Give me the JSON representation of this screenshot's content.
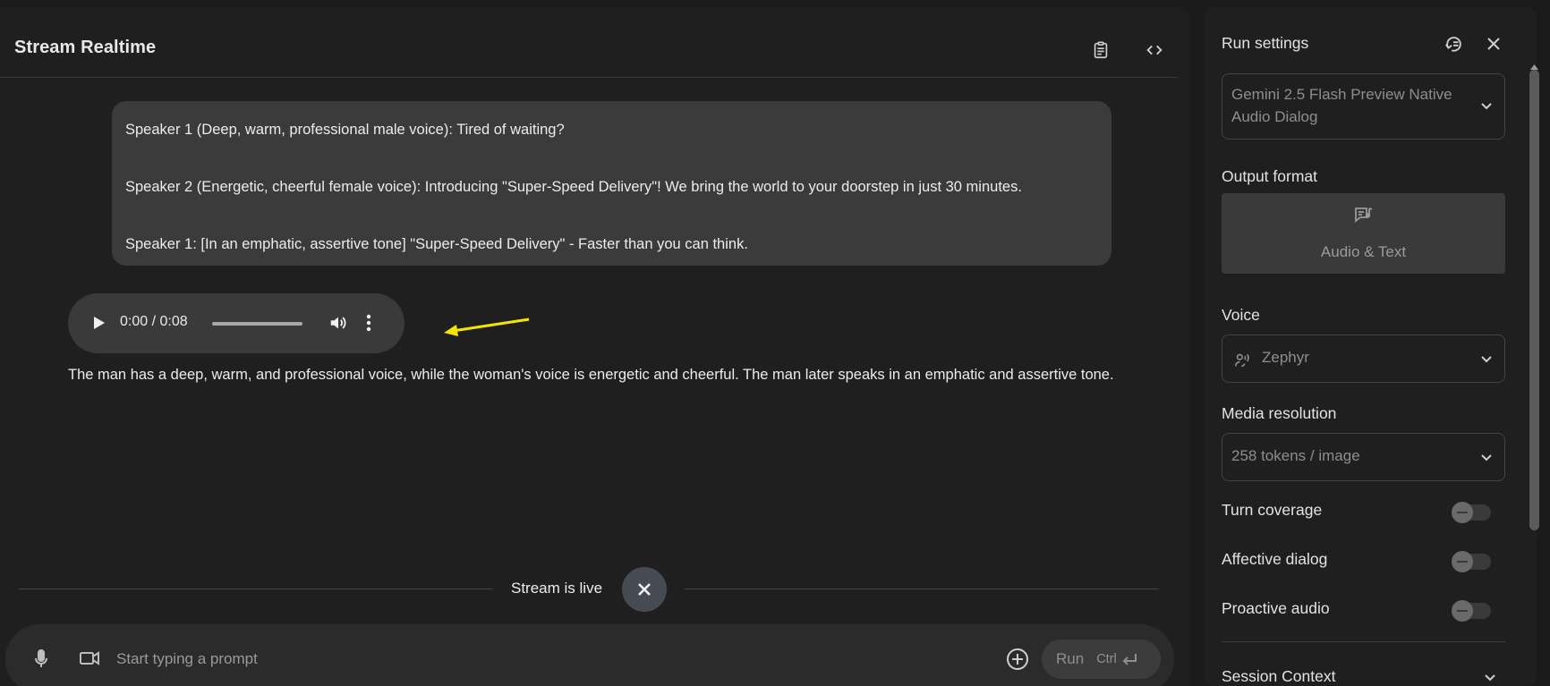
{
  "header": {
    "title": "Stream Realtime",
    "icons": [
      "clipboard-icon",
      "code-icon"
    ]
  },
  "chat": {
    "user_lines": [
      "Speaker 1 (Deep, warm, professional male voice): Tired of waiting?",
      "Speaker 2 (Energetic, cheerful female voice): Introducing \"Super-Speed Delivery\"! We bring the world to your doorstep in just 30 minutes.",
      "Speaker 1: [In an emphatic, assertive tone] \"Super-Speed Delivery\" - Faster than you can think."
    ],
    "audio": {
      "time_display": "0:00 / 0:08",
      "progress": 0
    },
    "response_text": "The man has a deep, warm, and professional voice, while the woman's voice is energetic and cheerful. The man later speaks in an emphatic and assertive tone.",
    "annotation_arrow_color": "#f2e600"
  },
  "stream": {
    "status_text": "Stream is live"
  },
  "prompt": {
    "placeholder": "Start typing a prompt",
    "run_label": "Run",
    "shortcut_label": "Ctrl"
  },
  "settings": {
    "title": "Run settings",
    "model": "Gemini 2.5 Flash Preview Native Audio Dialog",
    "output_format_label": "Output format",
    "output_format_value": "Audio & Text",
    "voice_label": "Voice",
    "voice_value": "Zephyr",
    "media_resolution_label": "Media resolution",
    "media_resolution_value": "258 tokens / image",
    "toggles": [
      {
        "label": "Turn coverage",
        "on": false
      },
      {
        "label": "Affective dialog",
        "on": false
      },
      {
        "label": "Proactive audio",
        "on": false
      }
    ],
    "session_context_label": "Session Context"
  },
  "colors": {
    "background": "#1b1b1b",
    "panel": "#1f1f1f",
    "bubble": "#3b3b3b",
    "muted_text": "#8e8e8e"
  }
}
